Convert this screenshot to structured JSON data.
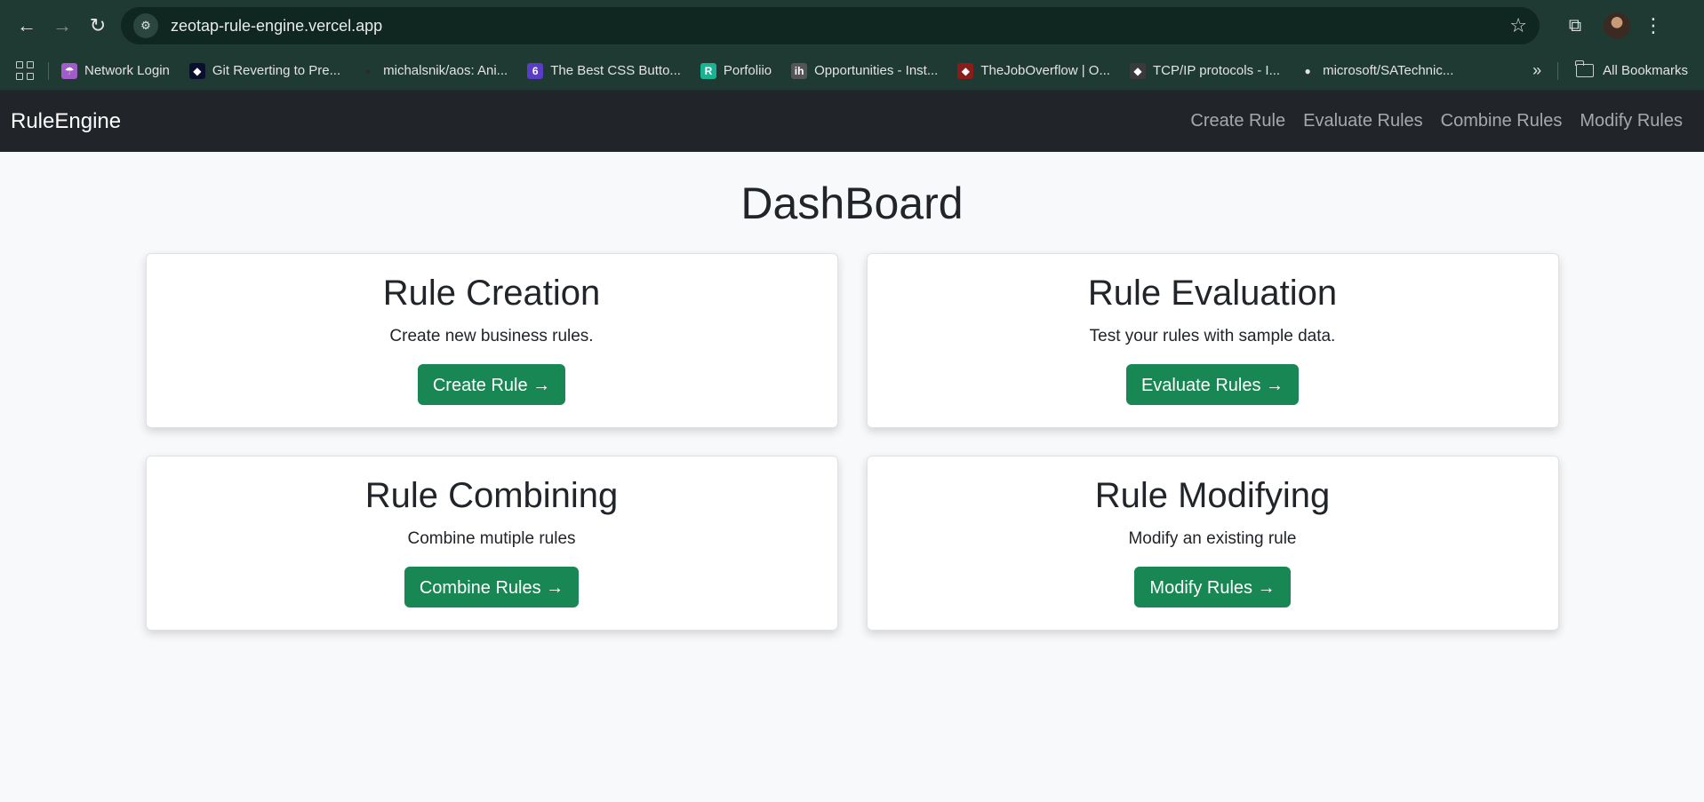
{
  "browser": {
    "url": "zeotap-rule-engine.vercel.app",
    "bookmarks": [
      {
        "label": "Network Login",
        "icon": "umbrella-icon",
        "color": "#a05cc8"
      },
      {
        "label": "Git Reverting to Pre...",
        "icon": "site-icon",
        "color": "#0b0f2e"
      },
      {
        "label": "michalsnik/aos: Ani...",
        "icon": "github-icon",
        "color": "#2b2b2b"
      },
      {
        "label": "The Best CSS Butto...",
        "icon": "six-icon",
        "color": "#5b3cc4"
      },
      {
        "label": "Porfoliio",
        "icon": "r-icon",
        "color": "#19b394"
      },
      {
        "label": "Opportunities - Inst...",
        "icon": "ih-icon",
        "color": "#555"
      },
      {
        "label": "TheJobOverflow | O...",
        "icon": "site-icon",
        "color": "#8a1c1c"
      },
      {
        "label": "TCP/IP protocols - I...",
        "icon": "site-icon",
        "color": "#3a3a3a"
      },
      {
        "label": "microsoft/SATechnic...",
        "icon": "github-icon",
        "color": "#e3e3e3"
      }
    ],
    "all_bookmarks": "All Bookmarks"
  },
  "app": {
    "brand": "RuleEngine",
    "nav": [
      "Create Rule",
      "Evaluate Rules",
      "Combine Rules",
      "Modify Rules"
    ]
  },
  "dashboard": {
    "title": "DashBoard",
    "cards": [
      {
        "title": "Rule Creation",
        "text": "Create new business rules.",
        "button": "Create Rule →"
      },
      {
        "title": "Rule Evaluation",
        "text": "Test your rules with sample data.",
        "button": "Evaluate Rules →"
      },
      {
        "title": "Rule Combining",
        "text": "Combine mutiple rules",
        "button": "Combine Rules →"
      },
      {
        "title": "Rule Modifying",
        "text": "Modify an existing rule",
        "button": "Modify Rules →"
      }
    ]
  },
  "colors": {
    "browser_frame": "#1e3a33",
    "navbar": "#212529",
    "button": "#198754",
    "background": "#f8f9fa"
  }
}
